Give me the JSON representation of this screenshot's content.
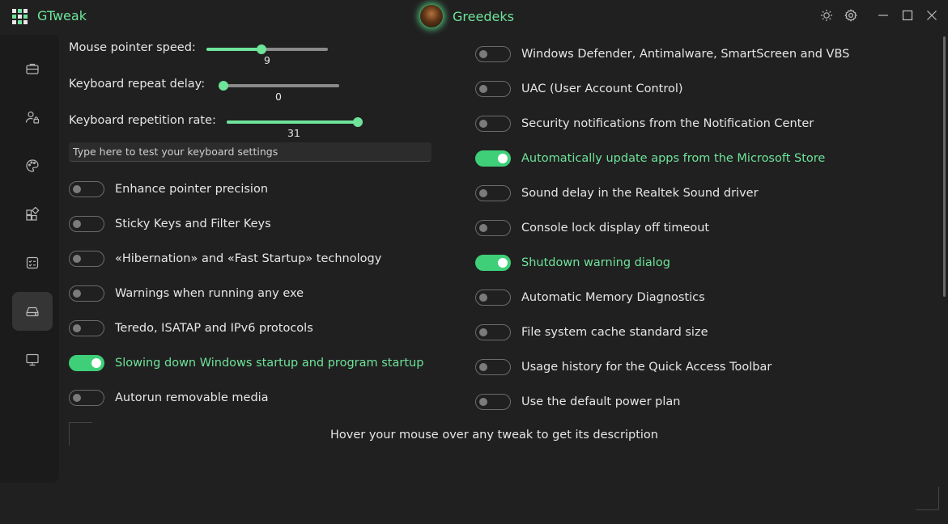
{
  "app": {
    "title": "GTweak",
    "logo_icon": "gtweak-logo-icon"
  },
  "profile": {
    "name": "Greedeks"
  },
  "titlebar_buttons": [
    {
      "icon": "sun-icon",
      "action": "theme"
    },
    {
      "icon": "gear-icon",
      "action": "settings"
    },
    {
      "icon": "minimize-icon",
      "action": "minimize"
    },
    {
      "icon": "maximize-icon",
      "action": "maximize"
    },
    {
      "icon": "close-icon",
      "action": "close"
    }
  ],
  "sidebar": {
    "items": [
      {
        "icon": "briefcase-icon",
        "active": false
      },
      {
        "icon": "user-lock-icon",
        "active": false
      },
      {
        "icon": "palette-icon",
        "active": false
      },
      {
        "icon": "apps-icon",
        "active": false
      },
      {
        "icon": "checklist-icon",
        "active": false
      },
      {
        "icon": "drive-icon",
        "active": true
      },
      {
        "icon": "monitor-icon",
        "active": false
      }
    ]
  },
  "sliders": [
    {
      "label": "Mouse pointer speed:",
      "value": "9",
      "fraction": 0.45
    },
    {
      "label": "Keyboard repeat delay:",
      "value": "0",
      "fraction": 0.0
    },
    {
      "label": "Keyboard repetition rate:",
      "value": "31",
      "fraction": 1.0
    }
  ],
  "keyboard_test": {
    "placeholder": "Type here to test your keyboard settings"
  },
  "left_toggles": [
    {
      "label": "Enhance pointer precision",
      "on": false
    },
    {
      "label": "Sticky Keys and Filter Keys",
      "on": false
    },
    {
      "label": "«Hibernation» and «Fast Startup» technology",
      "on": false
    },
    {
      "label": "Warnings when running any exe",
      "on": false
    },
    {
      "label": "Teredo, ISATAP and IPv6 protocols",
      "on": false
    },
    {
      "label": "Slowing down Windows startup and program startup",
      "on": true
    },
    {
      "label": "Autorun removable media",
      "on": false
    }
  ],
  "right_toggles": [
    {
      "label": "Windows Defender, Antimalware, SmartScreen and VBS",
      "on": false
    },
    {
      "label": "UAC (User Account Control)",
      "on": false
    },
    {
      "label": "Security notifications from the Notification Center",
      "on": false
    },
    {
      "label": "Automatically update apps from the Microsoft Store",
      "on": true
    },
    {
      "label": "Sound delay in the Realtek Sound driver",
      "on": false
    },
    {
      "label": "Console lock display off timeout",
      "on": false
    },
    {
      "label": "Shutdown warning dialog",
      "on": true
    },
    {
      "label": "Automatic Memory Diagnostics",
      "on": false
    },
    {
      "label": "File system cache standard size",
      "on": false
    },
    {
      "label": "Usage history for the Quick Access Toolbar",
      "on": false
    },
    {
      "label": "Use the default power plan",
      "on": false
    }
  ],
  "description": {
    "hint": "Hover your mouse over any tweak to get its description"
  },
  "colors": {
    "accent": "#6ee39a",
    "toggle_on": "#3fcf79",
    "background": "#202020",
    "sidebar": "#1b1b1b"
  }
}
